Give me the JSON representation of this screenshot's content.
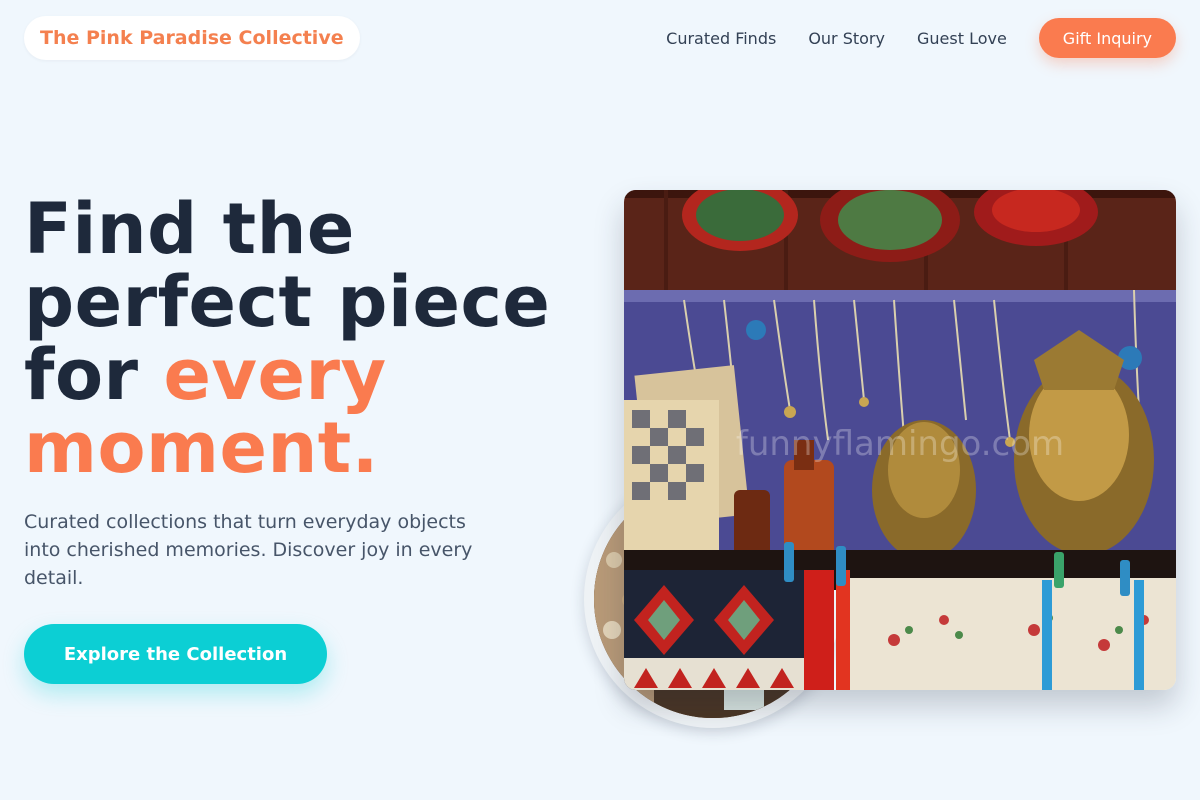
{
  "nav": {
    "brand": "The Pink Paradise Collective",
    "links": [
      "Curated Finds",
      "Our Story",
      "Guest Love"
    ],
    "cta": "Gift Inquiry"
  },
  "hero": {
    "title_line1": "Find the",
    "title_line2": "perfect piece",
    "title_line3_plain": "for ",
    "title_line3_accent": "every",
    "title_line4_accent": "moment.",
    "subtitle": "Curated collections that turn everyday objects into cherished memories. Discover joy in every detail.",
    "cta": "Explore the Collection"
  },
  "images": {
    "main_watermark": "funnyflamingo.com"
  },
  "colors": {
    "background": "#f0f7fd",
    "accent_orange": "#fa7b4f",
    "accent_teal": "#0ccfd4",
    "heading": "#1e293b",
    "body_text": "#475569"
  }
}
